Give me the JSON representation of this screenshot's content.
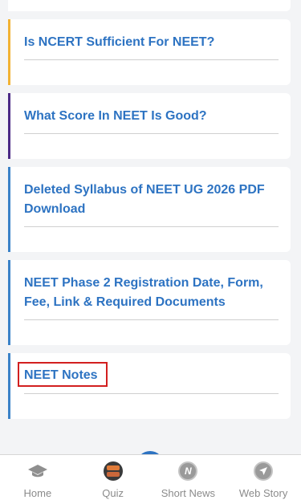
{
  "articles": [
    {
      "title": "Is NCERT Sufficient For NEET?",
      "accent": "#f2b233"
    },
    {
      "title": "What Score In NEET Is Good?",
      "accent": "#4b2a86"
    },
    {
      "title": "Deleted Syllabus of NEET UG 2026 PDF Download",
      "accent": "#3b82c8"
    },
    {
      "title": "NEET Phase 2 Registration Date, Form, Fee, Link & Required Documents",
      "accent": "#3b82c8"
    },
    {
      "title": "NEET Notes",
      "accent": "#3b82c8"
    }
  ],
  "bottom_nav": [
    {
      "label": "Home",
      "icon": "graduation-cap-icon"
    },
    {
      "label": "Quiz",
      "icon": "quiz-icon"
    },
    {
      "label": "Short News",
      "icon": "news-n-icon"
    },
    {
      "label": "Web Story",
      "icon": "navigation-arrow-icon"
    }
  ],
  "colors": {
    "title": "#2d73c2",
    "highlight": "#d21f1f",
    "nav_label": "#8b8b8b"
  }
}
